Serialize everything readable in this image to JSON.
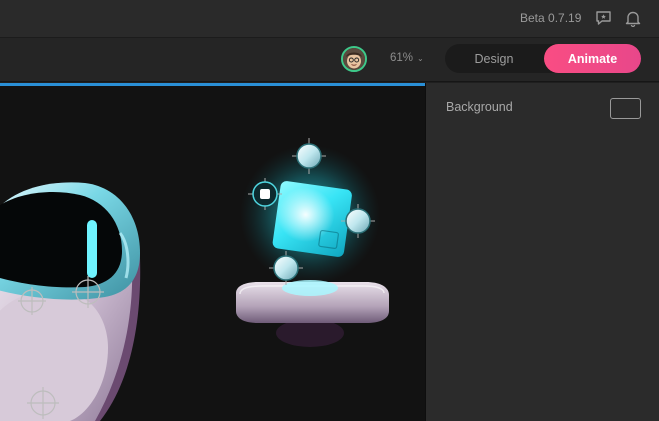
{
  "topbar": {
    "version": "Beta 0.7.19",
    "icons": [
      "feedback-icon",
      "bell-icon"
    ]
  },
  "toolbar": {
    "zoom": "61%",
    "modes": {
      "design": "Design",
      "animate": "Animate"
    },
    "active_mode": "Animate"
  },
  "panel": {
    "background_label": "Background"
  },
  "colors": {
    "accent": "#f94d83",
    "selection": "#2a8fd6",
    "avatar_ring": "#3ec98a"
  }
}
